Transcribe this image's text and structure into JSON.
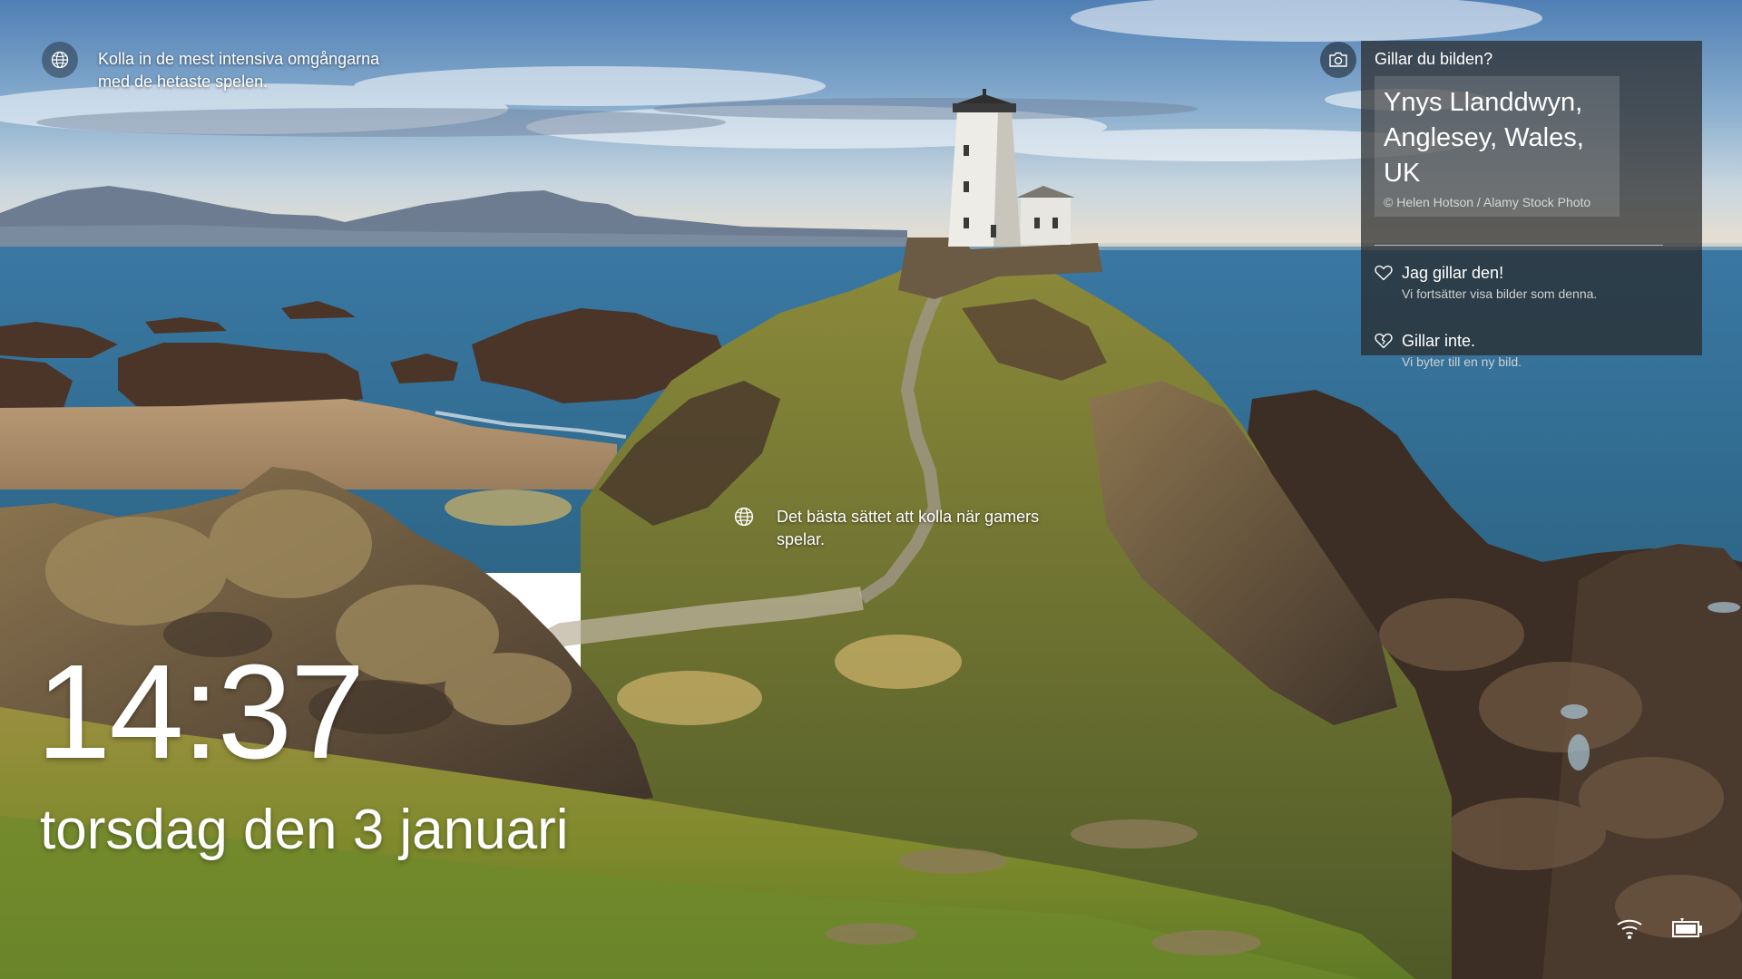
{
  "spotlight_top": {
    "icon": "globe-icon",
    "text": "Kolla in de mest intensiva omgångarna med de hetaste spelen."
  },
  "spotlight_mid": {
    "icon": "globe-icon",
    "text": "Det bästa sättet att kolla när gamers spelar."
  },
  "feedback_panel": {
    "camera_icon": "camera-icon",
    "heading": "Gillar du bilden?",
    "location": "Ynys Llanddwyn, Anglesey, Wales, UK",
    "credit": "© Helen Hotson / Alamy Stock Photo",
    "like": {
      "icon": "heart-icon",
      "label": "Jag gillar den!",
      "sub": "Vi fortsätter visa bilder som denna."
    },
    "dislike": {
      "icon": "broken-heart-icon",
      "label": "Gillar inte.",
      "sub": "Vi byter till en ny bild."
    }
  },
  "clock": {
    "time": "14:37",
    "date": "torsdag den 3 januari"
  },
  "status": {
    "network_icon": "wifi-icon",
    "battery_icon": "battery-icon"
  },
  "colors": {
    "sky_top": "#5a86b8",
    "sea": "#2f6a94",
    "grass": "#8a8a2e",
    "rock": "#5a4a3a",
    "panel_bg": "#282828"
  }
}
